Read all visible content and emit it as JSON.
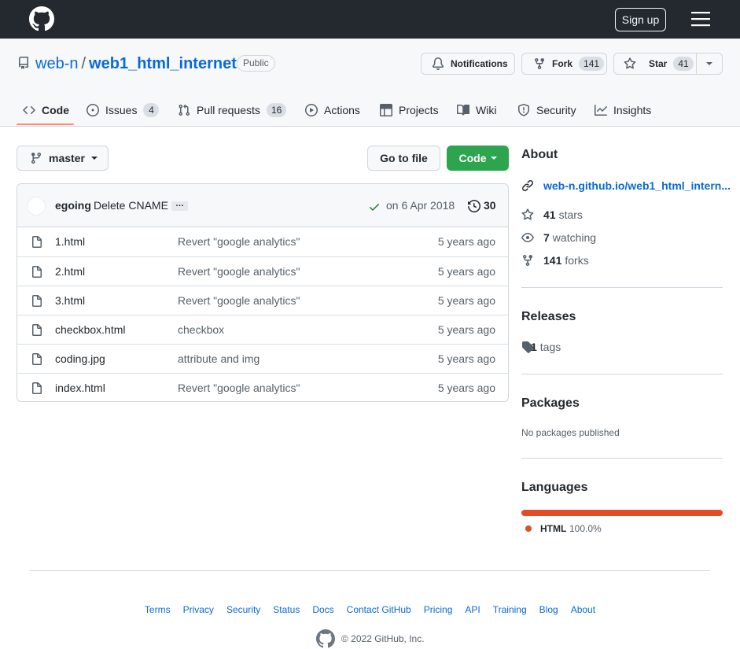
{
  "header": {
    "signup_label": "Sign up"
  },
  "repo": {
    "owner": "web-n",
    "separator": "/",
    "name": "web1_html_internet",
    "visibility": "Public",
    "notifications_label": "Notifications",
    "fork_label": "Fork",
    "fork_count": "141",
    "star_label": "Star",
    "star_count": "41"
  },
  "tabs": [
    {
      "label": "Code",
      "icon": "code-icon"
    },
    {
      "label": "Issues",
      "count": "4",
      "icon": "issue-icon"
    },
    {
      "label": "Pull requests",
      "count": "16",
      "icon": "pull-request-icon"
    },
    {
      "label": "Actions",
      "icon": "play-icon"
    },
    {
      "label": "Projects",
      "icon": "table-icon"
    },
    {
      "label": "Wiki",
      "icon": "book-icon"
    },
    {
      "label": "Security",
      "icon": "shield-icon"
    },
    {
      "label": "Insights",
      "icon": "graph-icon"
    }
  ],
  "branch": {
    "name": "master",
    "go_to_file": "Go to file",
    "code_label": "Code"
  },
  "commit": {
    "author": "egoing",
    "message": "Delete CNAME",
    "ellipsis": "…",
    "date": "on 6 Apr 2018",
    "count": "30"
  },
  "files": [
    {
      "name": "1.html",
      "message": "Revert \"google analytics\"",
      "age": "5 years ago"
    },
    {
      "name": "2.html",
      "message": "Revert \"google analytics\"",
      "age": "5 years ago"
    },
    {
      "name": "3.html",
      "message": "Revert \"google analytics\"",
      "age": "5 years ago"
    },
    {
      "name": "checkbox.html",
      "message": "checkbox",
      "age": "5 years ago"
    },
    {
      "name": "coding.jpg",
      "message": "attribute and img",
      "age": "5 years ago"
    },
    {
      "name": "index.html",
      "message": "Revert \"google analytics\"",
      "age": "5 years ago"
    }
  ],
  "sidebar": {
    "about_title": "About",
    "website": "web-n.github.io/web1_html_intern...",
    "stars_count": "41",
    "stars_label": "stars",
    "watching_count": "7",
    "watching_label": "watching",
    "forks_count": "141",
    "forks_label": "forks",
    "releases_title": "Releases",
    "tags_count": "1",
    "tags_label": "tags",
    "packages_title": "Packages",
    "packages_text": "No packages published",
    "languages_title": "Languages",
    "language_name": "HTML",
    "language_pct": "100.0%",
    "language_fraction": 1.0,
    "language_color": "#e34c26"
  },
  "footer": {
    "links": [
      "Terms",
      "Privacy",
      "Security",
      "Status",
      "Docs",
      "Contact GitHub",
      "Pricing",
      "API",
      "Training",
      "Blog",
      "About"
    ],
    "copyright": "© 2022 GitHub, Inc."
  },
  "colors": {
    "header_bg": "#24292f",
    "link": "#0969da",
    "primary_button": "#2da44e",
    "tab_underline": "#fd8c73"
  }
}
